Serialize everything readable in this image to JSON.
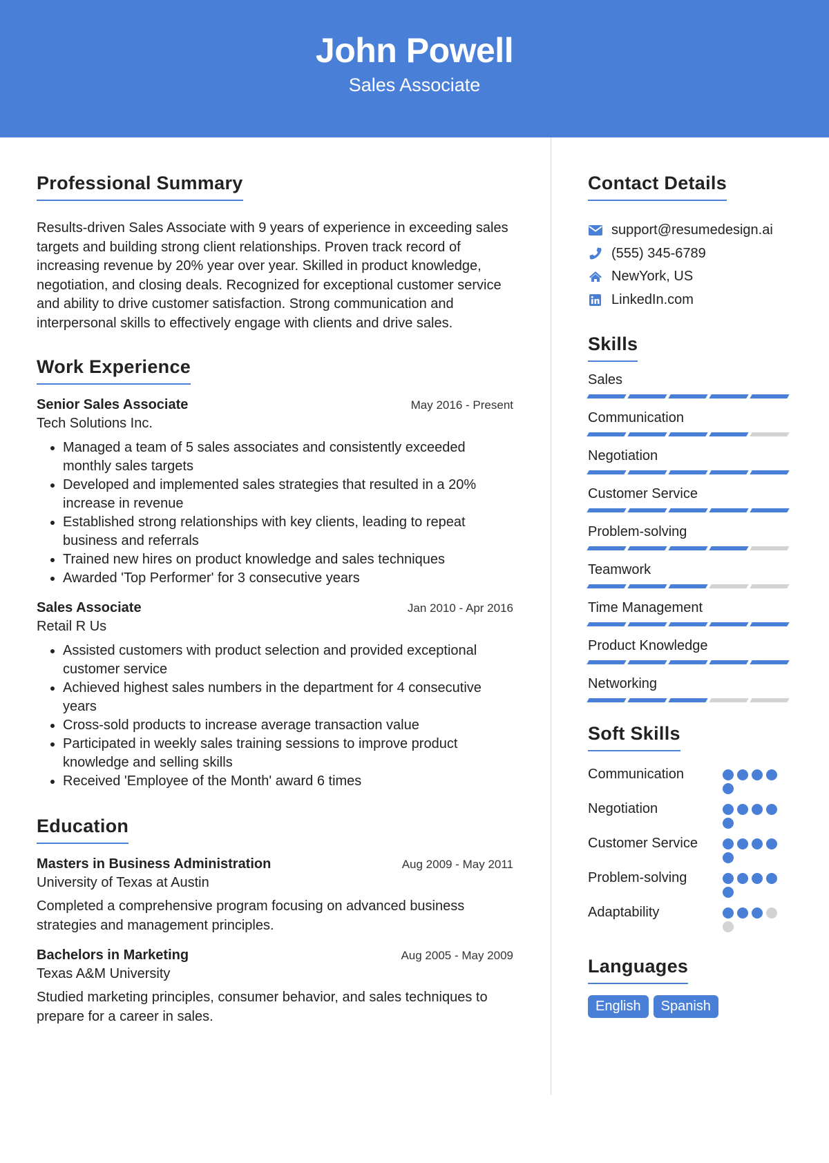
{
  "header": {
    "name": "John Powell",
    "title": "Sales Associate"
  },
  "colors": {
    "accent": "#4a7fd8",
    "inactive": "#d3d3d3"
  },
  "summary": {
    "title": "Professional Summary",
    "text": "Results-driven Sales Associate with 9 years of experience in exceeding sales targets and building strong client relationships. Proven track record of increasing revenue by 20% year over year. Skilled in product knowledge, negotiation, and closing deals. Recognized for exceptional customer service and ability to drive customer satisfaction. Strong communication and interpersonal skills to effectively engage with clients and drive sales."
  },
  "experience": {
    "title": "Work Experience",
    "jobs": [
      {
        "title": "Senior Sales Associate",
        "date": "May 2016 - Present",
        "org": "Tech Solutions Inc.",
        "bullets": [
          "Managed a team of 5 sales associates and consistently exceeded monthly sales targets",
          "Developed and implemented sales strategies that resulted in a 20% increase in revenue",
          "Established strong relationships with key clients, leading to repeat business and referrals",
          "Trained new hires on product knowledge and sales techniques",
          "Awarded 'Top Performer' for 3 consecutive years"
        ]
      },
      {
        "title": "Sales Associate",
        "date": "Jan 2010 - Apr 2016",
        "org": "Retail R Us",
        "bullets": [
          "Assisted customers with product selection and provided exceptional customer service",
          "Achieved highest sales numbers in the department for 4 consecutive years",
          "Cross-sold products to increase average transaction value",
          "Participated in weekly sales training sessions to improve product knowledge and selling skills",
          "Received 'Employee of the Month' award 6 times"
        ]
      }
    ]
  },
  "education": {
    "title": "Education",
    "items": [
      {
        "degree": "Masters in Business Administration",
        "date": "Aug 2009 - May 2011",
        "school": "University of Texas at Austin",
        "desc": "Completed a comprehensive program focusing on advanced business strategies and management principles."
      },
      {
        "degree": "Bachelors in Marketing",
        "date": "Aug 2005 - May 2009",
        "school": "Texas A&M University",
        "desc": "Studied marketing principles, consumer behavior, and sales techniques to prepare for a career in sales."
      }
    ]
  },
  "contact": {
    "title": "Contact Details",
    "items": [
      {
        "icon": "envelope-icon",
        "text": "support@resumedesign.ai"
      },
      {
        "icon": "phone-icon",
        "text": "(555) 345-6789"
      },
      {
        "icon": "home-icon",
        "text": "NewYork, US"
      },
      {
        "icon": "linkedin-icon",
        "text": "LinkedIn.com"
      }
    ]
  },
  "skills": {
    "title": "Skills",
    "max": 5,
    "items": [
      {
        "name": "Sales",
        "level": 5
      },
      {
        "name": "Communication",
        "level": 4
      },
      {
        "name": "Negotiation",
        "level": 5
      },
      {
        "name": "Customer Service",
        "level": 5
      },
      {
        "name": "Problem-solving",
        "level": 4
      },
      {
        "name": "Teamwork",
        "level": 3
      },
      {
        "name": "Time Management",
        "level": 5
      },
      {
        "name": "Product Knowledge",
        "level": 5
      },
      {
        "name": "Networking",
        "level": 3
      }
    ]
  },
  "soft_skills": {
    "title": "Soft Skills",
    "max": 5,
    "items": [
      {
        "name": "Communication",
        "level": 5
      },
      {
        "name": "Negotiation",
        "level": 5
      },
      {
        "name": "Customer Service",
        "level": 5
      },
      {
        "name": "Problem-solving",
        "level": 5
      },
      {
        "name": "Adaptability",
        "level": 3
      }
    ]
  },
  "languages": {
    "title": "Languages",
    "items": [
      "English",
      "Spanish"
    ]
  }
}
